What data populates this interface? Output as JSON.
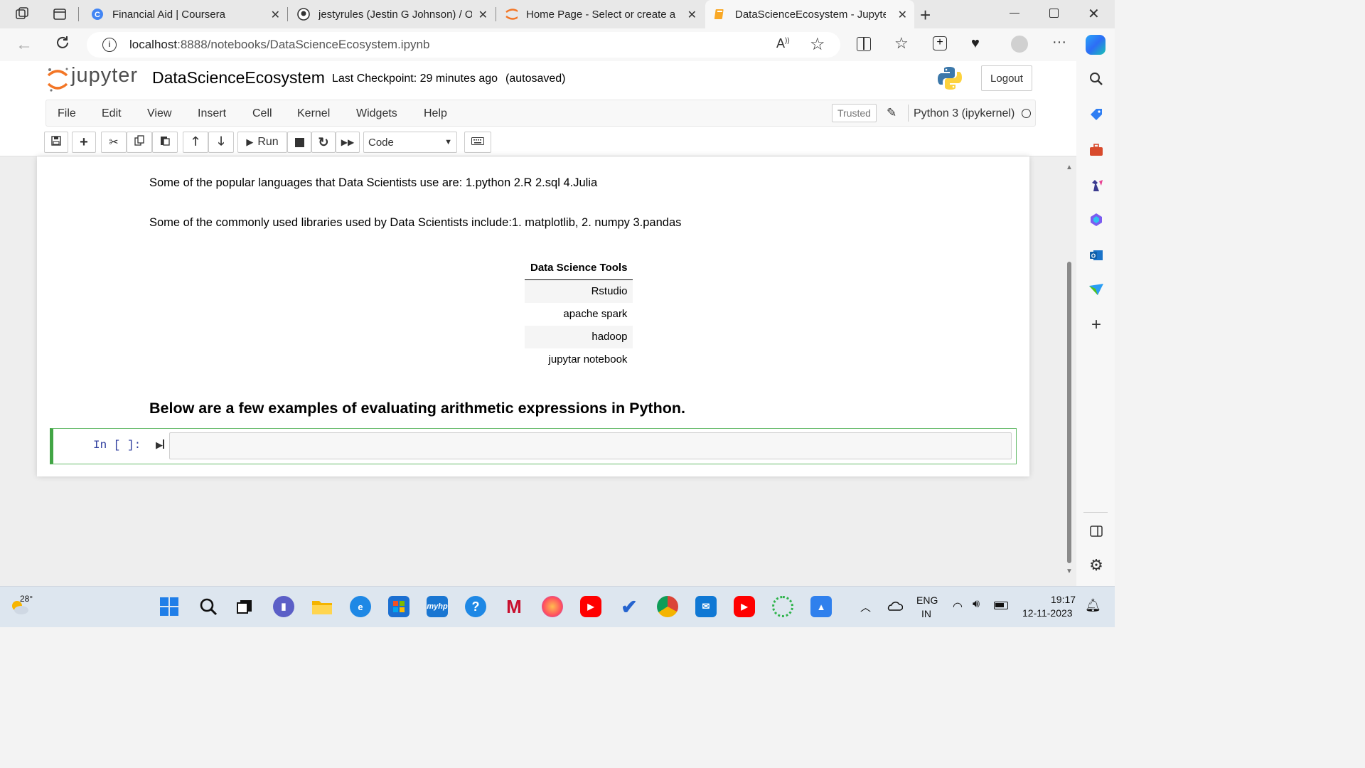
{
  "browser": {
    "tabs": [
      {
        "title": "Financial Aid | Coursera",
        "icon": "coursera-icon"
      },
      {
        "title": "jestyrules (Jestin G Johnson) / Oc",
        "icon": "github-icon"
      },
      {
        "title": "Home Page - Select or create a n",
        "icon": "jupyter-icon"
      },
      {
        "title": "DataScienceEcosystem - Jupyter",
        "icon": "notebook-icon"
      }
    ],
    "url_host": "localhost",
    "url_rest": ":8888/notebooks/DataScienceEcosystem.ipynb"
  },
  "jupyter": {
    "logo_text": "jupyter",
    "notebook_name": "DataScienceEcosystem",
    "checkpoint": "Last Checkpoint: 29 minutes ago",
    "autosave": "(autosaved)",
    "logout_label": "Logout",
    "menu": [
      "File",
      "Edit",
      "View",
      "Insert",
      "Cell",
      "Kernel",
      "Widgets",
      "Help"
    ],
    "trusted_label": "Trusted",
    "kernel_name": "Python 3 (ipykernel)",
    "run_label": "Run",
    "cell_type": "Code"
  },
  "content": {
    "languages_text": "Some of the popular languages that Data Scientists use are: 1.python 2.R 2.sql 4.Julia",
    "libraries_text": "Some of the commonly used libraries used by Data Scientists include:1. matplotlib, 2. numpy 3.pandas",
    "table_header": "Data Science Tools",
    "table_rows": [
      "Rstudio",
      "apache spark",
      "hadoop",
      "jupytar notebook"
    ],
    "heading": "Below are a few examples of evaluating arithmetic expressions in Python.",
    "prompt": "In [ ]:"
  },
  "taskbar": {
    "temperature": "28°",
    "lang_top": "ENG",
    "lang_bottom": "IN",
    "time": "19:17",
    "date": "12-11-2023"
  },
  "colors": {
    "jupyter_orange": "#f37626",
    "cell_green": "#42a545"
  }
}
